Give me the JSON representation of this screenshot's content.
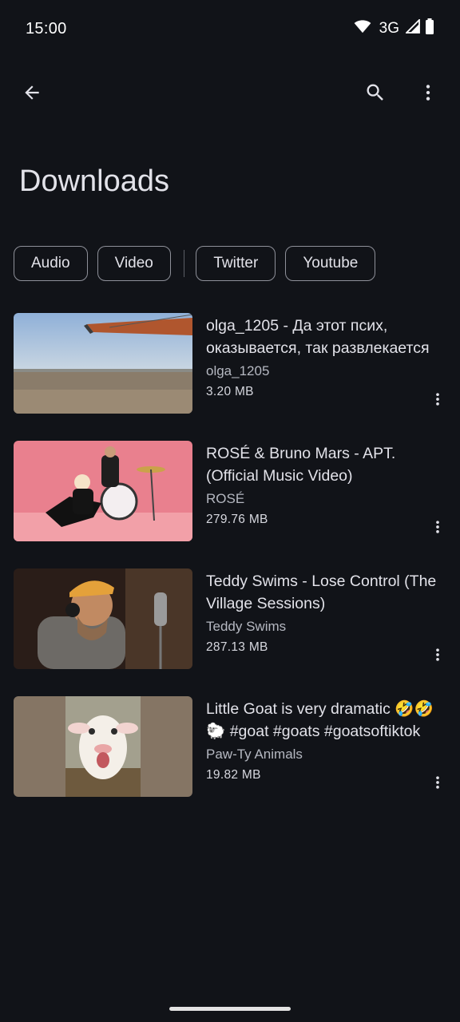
{
  "status_bar": {
    "time": "15:00",
    "network": "3G",
    "icons": [
      "wifi-icon",
      "cell-signal-icon",
      "battery-icon"
    ]
  },
  "top_bar": {
    "back_icon": "arrow-back-icon",
    "search_icon": "search-icon",
    "more_icon": "more-vert-icon"
  },
  "page": {
    "title": "Downloads"
  },
  "filters": [
    {
      "label": "Audio"
    },
    {
      "label": "Video"
    },
    {
      "label": "Twitter"
    },
    {
      "label": "Youtube"
    }
  ],
  "downloads": [
    {
      "title": "olga_1205 - Да этот псих, оказывается, так развлекается",
      "channel": "olga_1205",
      "size": "3.20 MB"
    },
    {
      "title": "ROSÉ & Bruno Mars - APT. (Official Music Video)",
      "channel": "ROSÉ",
      "size": "279.76 MB"
    },
    {
      "title": "Teddy Swims - Lose Control (The Village Sessions)",
      "channel": "Teddy Swims",
      "size": "287.13 MB"
    },
    {
      "title": "Little Goat is very dramatic 🤣🤣🐑 #goat #goats #goatsoftiktok",
      "channel": "Paw-Ty Animals",
      "size": "19.82 MB"
    }
  ],
  "colors": {
    "background": "#111318",
    "text_primary": "#e2e2e9",
    "text_secondary": "#b5b8c1",
    "chip_border": "#8e9099"
  }
}
